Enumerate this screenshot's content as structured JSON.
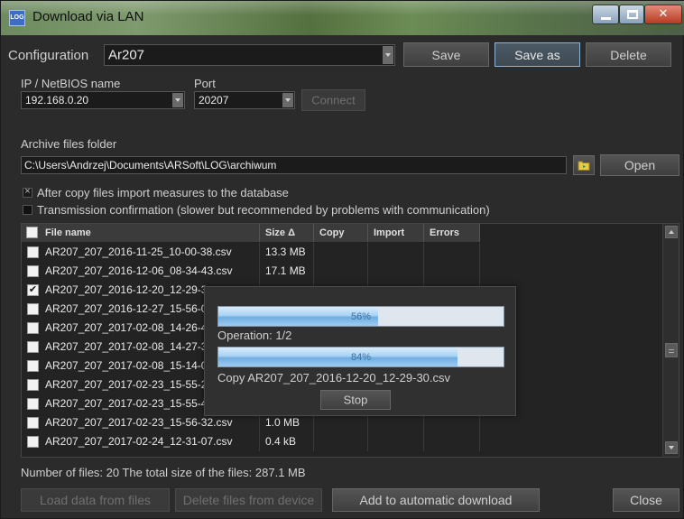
{
  "window": {
    "title": "Download via LAN",
    "icon_label": "LOG"
  },
  "config": {
    "label": "Configuration",
    "value": "Ar207",
    "save": "Save",
    "save_as": "Save as",
    "delete": "Delete"
  },
  "connection": {
    "ip_label": "IP / NetBIOS name",
    "ip_value": "192.168.0.20",
    "port_label": "Port",
    "port_value": "20207",
    "connect": "Connect"
  },
  "archive": {
    "label": "Archive files folder",
    "path": "C:\\Users\\Andrzej\\Documents\\ARSoft\\LOG\\archiwum",
    "open": "Open",
    "folder_icon": "folder-icon"
  },
  "options": {
    "import_measures": {
      "label": "After copy files import measures to the database",
      "checked": true,
      "mark": "×"
    },
    "transmission_confirm": {
      "label": "Transmission confirmation (slower but recommended by problems with communication)",
      "checked": false
    }
  },
  "table": {
    "columns": {
      "file_name": "File name",
      "size": "Size Δ",
      "copy": "Copy",
      "import": "Import",
      "errors": "Errors"
    },
    "check_mark": "✔",
    "rows": [
      {
        "name": "AR207_207_2016-11-25_10-00-38.csv",
        "size": "13.3 MB",
        "checked": false
      },
      {
        "name": "AR207_207_2016-12-06_08-34-43.csv",
        "size": "17.1 MB",
        "checked": false
      },
      {
        "name": "AR207_207_2016-12-20_12-29-3",
        "size": "",
        "checked": true
      },
      {
        "name": "AR207_207_2016-12-27_15-56-0",
        "size": "",
        "checked": false
      },
      {
        "name": "AR207_207_2017-02-08_14-26-4",
        "size": "",
        "checked": false
      },
      {
        "name": "AR207_207_2017-02-08_14-27-3",
        "size": "",
        "checked": false
      },
      {
        "name": "AR207_207_2017-02-08_15-14-0",
        "size": "",
        "checked": false
      },
      {
        "name": "AR207_207_2017-02-23_15-55-2",
        "size": "",
        "checked": false
      },
      {
        "name": "AR207_207_2017-02-23_15-55-4",
        "size": "",
        "checked": false
      },
      {
        "name": "AR207_207_2017-02-23_15-56-32.csv",
        "size": "1.0 MB",
        "checked": false
      },
      {
        "name": "AR207_207_2017-02-24_12-31-07.csv",
        "size": "0.4 kB",
        "checked": false
      }
    ]
  },
  "progress": {
    "overall_percent": 56,
    "overall_label": "56%",
    "operation_text": "Operation: 1/2",
    "file_percent": 84,
    "file_label": "84%",
    "current_file_text": "Copy AR207_207_2016-12-20_12-29-30.csv",
    "stop": "Stop"
  },
  "footer": {
    "summary": "Number of files: 20   The total size of the files: 287.1 MB",
    "load_data": "Load data from files",
    "delete_files": "Delete files from device",
    "add_auto": "Add to automatic download",
    "close": "Close"
  }
}
